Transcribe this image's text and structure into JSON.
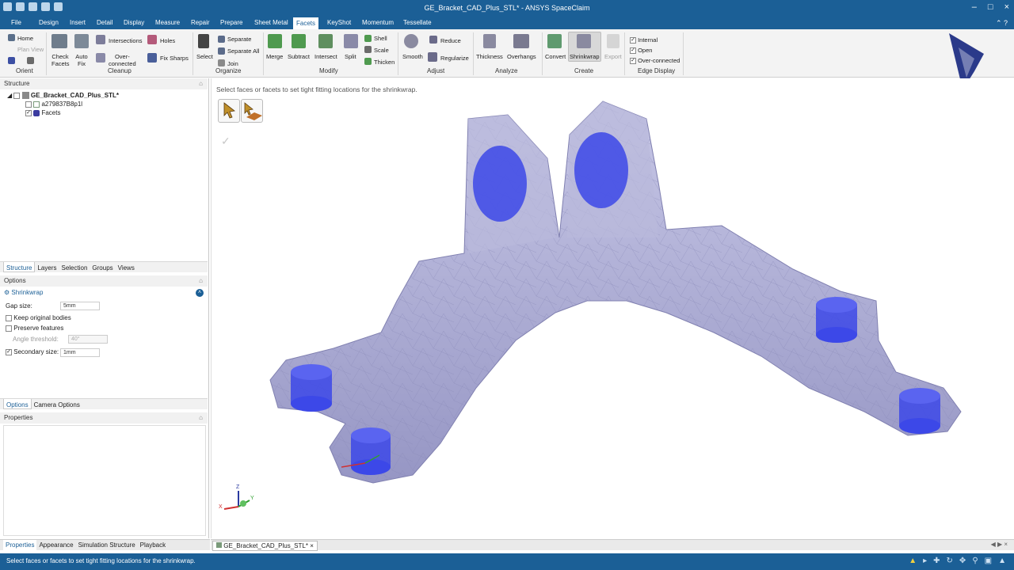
{
  "window": {
    "title": "GE_Bracket_CAD_Plus_STL* - ANSYS SpaceClaim"
  },
  "menu": {
    "tabs": [
      "File",
      "Design",
      "Insert",
      "Detail",
      "Display",
      "Measure",
      "Repair",
      "Prepare",
      "Sheet Metal",
      "Facets",
      "KeyShot",
      "Momentum",
      "Tessellate"
    ],
    "active": "Facets"
  },
  "ribbon": {
    "orient": {
      "home": "Home",
      "plan_view": "Plan View",
      "group": "Orient"
    },
    "cleanup": {
      "check_facets_1": "Check",
      "check_facets_2": "Facets",
      "auto_fix_1": "Auto",
      "auto_fix_2": "Fix",
      "intersections": "Intersections",
      "overconnected_1": "Over-",
      "overconnected_2": "connected",
      "holes": "Holes",
      "fix_sharps": "Fix Sharps",
      "group": "Cleanup"
    },
    "organize": {
      "select": "Select",
      "separate": "Separate",
      "separate_all": "Separate All",
      "join": "Join",
      "group": "Organize"
    },
    "modify": {
      "merge": "Merge",
      "subtract": "Subtract",
      "intersect": "Intersect",
      "split": "Split",
      "shell": "Shell",
      "scale": "Scale",
      "thicken": "Thicken",
      "group": "Modify"
    },
    "adjust": {
      "smooth": "Smooth",
      "reduce": "Reduce",
      "regularize": "Regularize",
      "group": "Adjust"
    },
    "analyze": {
      "thickness": "Thickness",
      "overhangs": "Overhangs",
      "group": "Analyze"
    },
    "create": {
      "convert": "Convert",
      "shrinkwrap": "Shrinkwrap",
      "export": "Export",
      "group": "Create"
    },
    "edge_display": {
      "internal": "Internal",
      "open": "Open",
      "overconnected": "Over-connected",
      "group": "Edge Display"
    }
  },
  "structure": {
    "header": "Structure",
    "root": "GE_Bracket_CAD_Plus_STL*",
    "child1": "a279837B8p1l",
    "child2": "Facets",
    "tabs": [
      "Structure",
      "Layers",
      "Selection",
      "Groups",
      "Views"
    ]
  },
  "options": {
    "header": "Options",
    "tool": "Shrinkwrap",
    "gap_label": "Gap size:",
    "gap_value": "5mm",
    "keep_original": "Keep original bodies",
    "preserve_features": "Preserve features",
    "angle_label": "Angle threshold:",
    "angle_value": "40°",
    "secondary_label": "Secondary size:",
    "secondary_value": "1mm",
    "tabs": [
      "Options",
      "Camera Options"
    ]
  },
  "properties": {
    "header": "Properties",
    "tabs": [
      "Properties",
      "Appearance",
      "Simulation Structure",
      "Playback"
    ]
  },
  "viewport": {
    "hint": "Select faces or facets to set tight fitting locations for the shrinkwrap.",
    "axis_x": "X",
    "axis_y": "Y",
    "axis_z": "Z"
  },
  "doc_tab": {
    "label": "GE_Bracket_CAD_Plus_STL*",
    "close": "×"
  },
  "status": {
    "text": "Select faces or facets to set tight fitting locations for the shrinkwrap."
  },
  "colors": {
    "accent": "#1b5f96",
    "mesh": "#a9a9d3",
    "holes": "#3c48e8"
  }
}
